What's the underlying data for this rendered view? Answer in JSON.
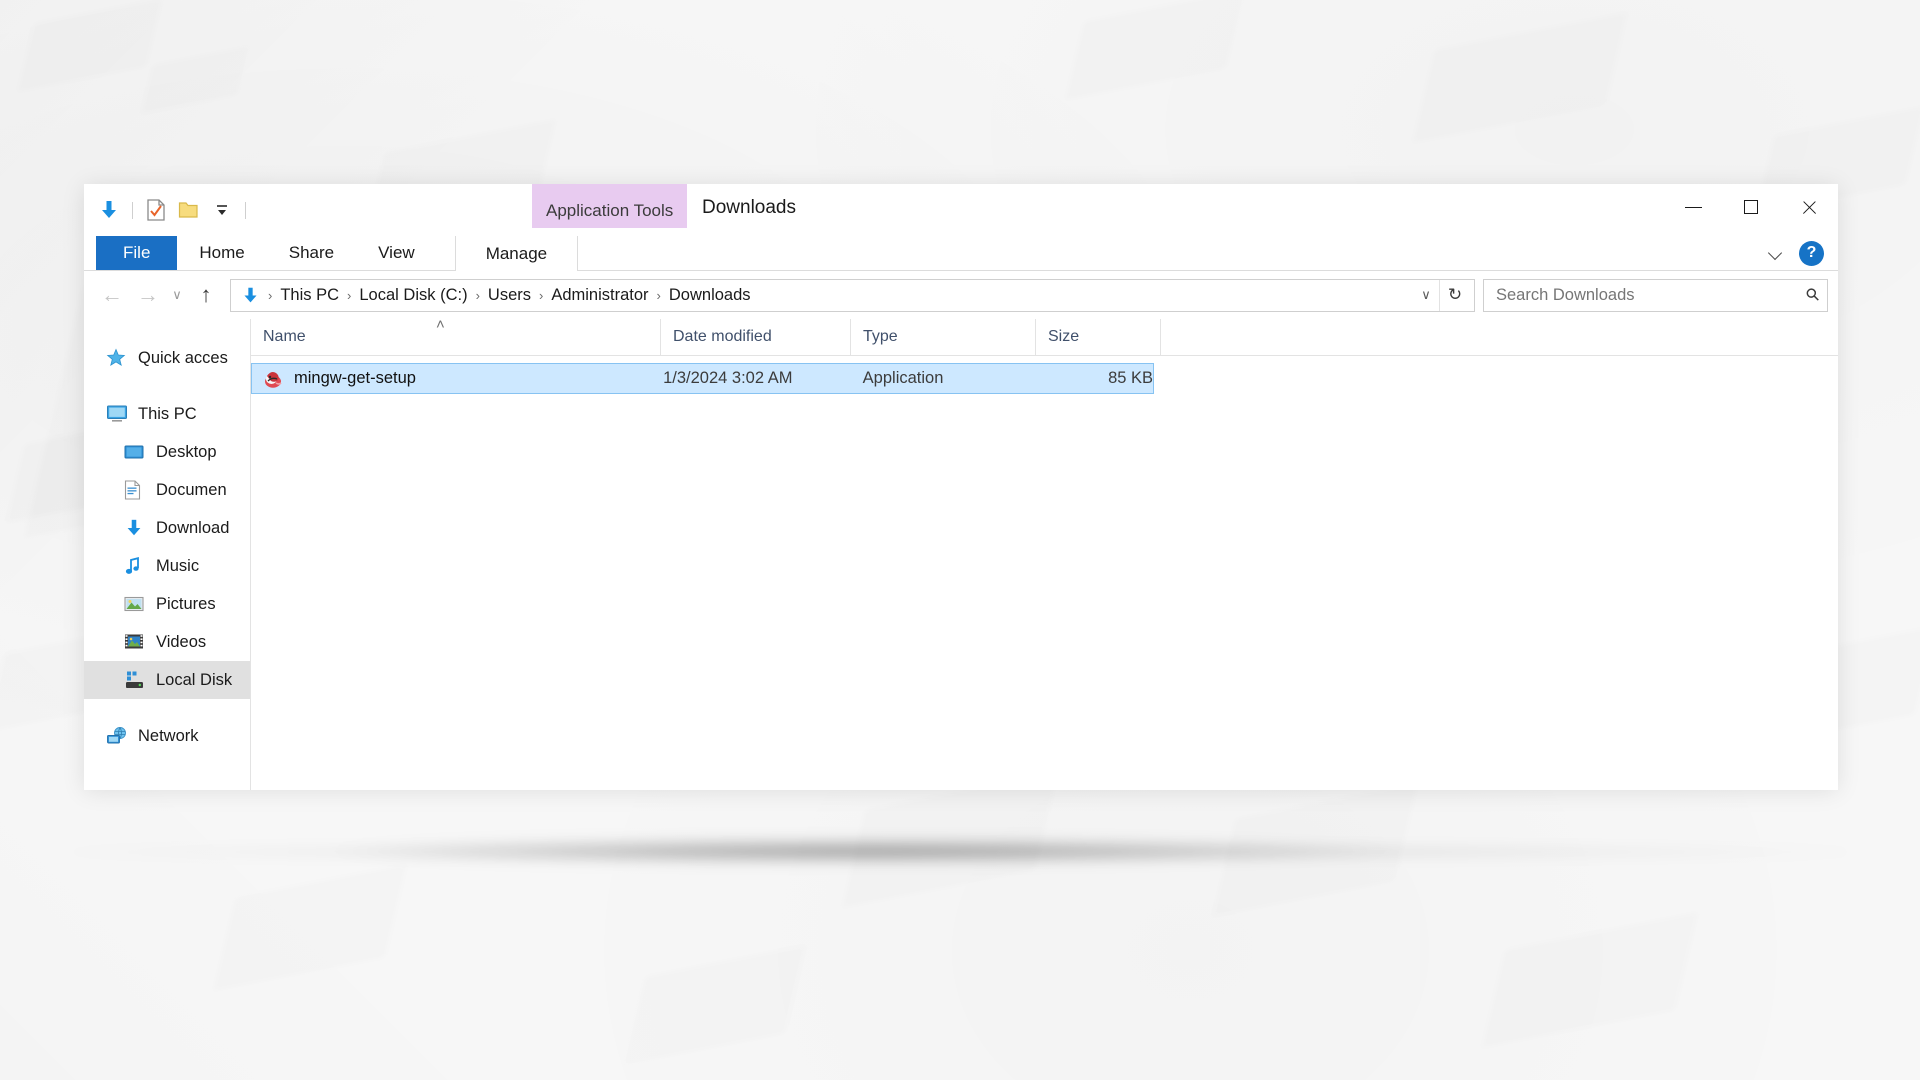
{
  "window": {
    "title": "Downloads",
    "contextual_tab": "Application Tools",
    "controls": {
      "minimize": "minimize-button",
      "maximize": "maximize-button",
      "close": "close-button"
    }
  },
  "quick_access_toolbar": {
    "items": [
      {
        "name": "downloads-folder-icon",
        "label": "Downloads"
      },
      {
        "name": "properties-icon",
        "label": "Properties"
      },
      {
        "name": "new-folder-icon",
        "label": "New folder"
      },
      {
        "name": "customize-dropdown-icon",
        "label": "Customize Quick Access Toolbar"
      }
    ]
  },
  "ribbon": {
    "tabs": [
      {
        "label": "File",
        "selected": true
      },
      {
        "label": "Home",
        "selected": false
      },
      {
        "label": "Share",
        "selected": false
      },
      {
        "label": "View",
        "selected": false
      }
    ],
    "contextual_tabs": [
      {
        "label": "Manage",
        "selected": false
      }
    ],
    "collapse_label": "Minimize the Ribbon",
    "help_label": "?"
  },
  "navigation": {
    "back": "←",
    "forward": "→",
    "recent": "∨",
    "up": "↑",
    "dropdown": "∨",
    "refresh": "↻"
  },
  "address": {
    "crumbs": [
      "This PC",
      "Local Disk (C:)",
      "Users",
      "Administrator",
      "Downloads"
    ],
    "separator": "›"
  },
  "search": {
    "placeholder": "Search Downloads",
    "value": ""
  },
  "sidebar": {
    "items": [
      {
        "label": "Quick acces",
        "icon": "star-icon",
        "indent": false,
        "selected": false
      },
      {
        "label": "This PC",
        "icon": "monitor-icon",
        "indent": false,
        "selected": false
      },
      {
        "label": "Desktop",
        "icon": "desktop-icon",
        "indent": true,
        "selected": false
      },
      {
        "label": "Documen",
        "icon": "documents-icon",
        "indent": true,
        "selected": false
      },
      {
        "label": "Download",
        "icon": "downloads-icon",
        "indent": true,
        "selected": false
      },
      {
        "label": "Music",
        "icon": "music-icon",
        "indent": true,
        "selected": false
      },
      {
        "label": "Pictures",
        "icon": "pictures-icon",
        "indent": true,
        "selected": false
      },
      {
        "label": "Videos",
        "icon": "videos-icon",
        "indent": true,
        "selected": false
      },
      {
        "label": "Local Disk",
        "icon": "local-disk-icon",
        "indent": true,
        "selected": true
      },
      {
        "label": "Network",
        "icon": "network-icon",
        "indent": false,
        "selected": false
      }
    ]
  },
  "file_list": {
    "columns": [
      {
        "key": "name",
        "label": "Name",
        "sorted": "asc",
        "sort_glyph": "˄"
      },
      {
        "key": "date",
        "label": "Date modified",
        "sorted": ""
      },
      {
        "key": "type",
        "label": "Type",
        "sorted": ""
      },
      {
        "key": "size",
        "label": "Size",
        "sorted": ""
      }
    ],
    "rows": [
      {
        "name": "mingw-get-setup",
        "date": "1/3/2024 3:02 AM",
        "type": "Application",
        "size": "85 KB",
        "icon": "mingw-application-icon",
        "selected": true
      }
    ]
  },
  "colors": {
    "accent": "#1a6fc4",
    "contextual_tab": "#e8cbf0",
    "selection": "#cde8ff",
    "selection_border": "#87c3f2",
    "header_text": "#40506b"
  }
}
